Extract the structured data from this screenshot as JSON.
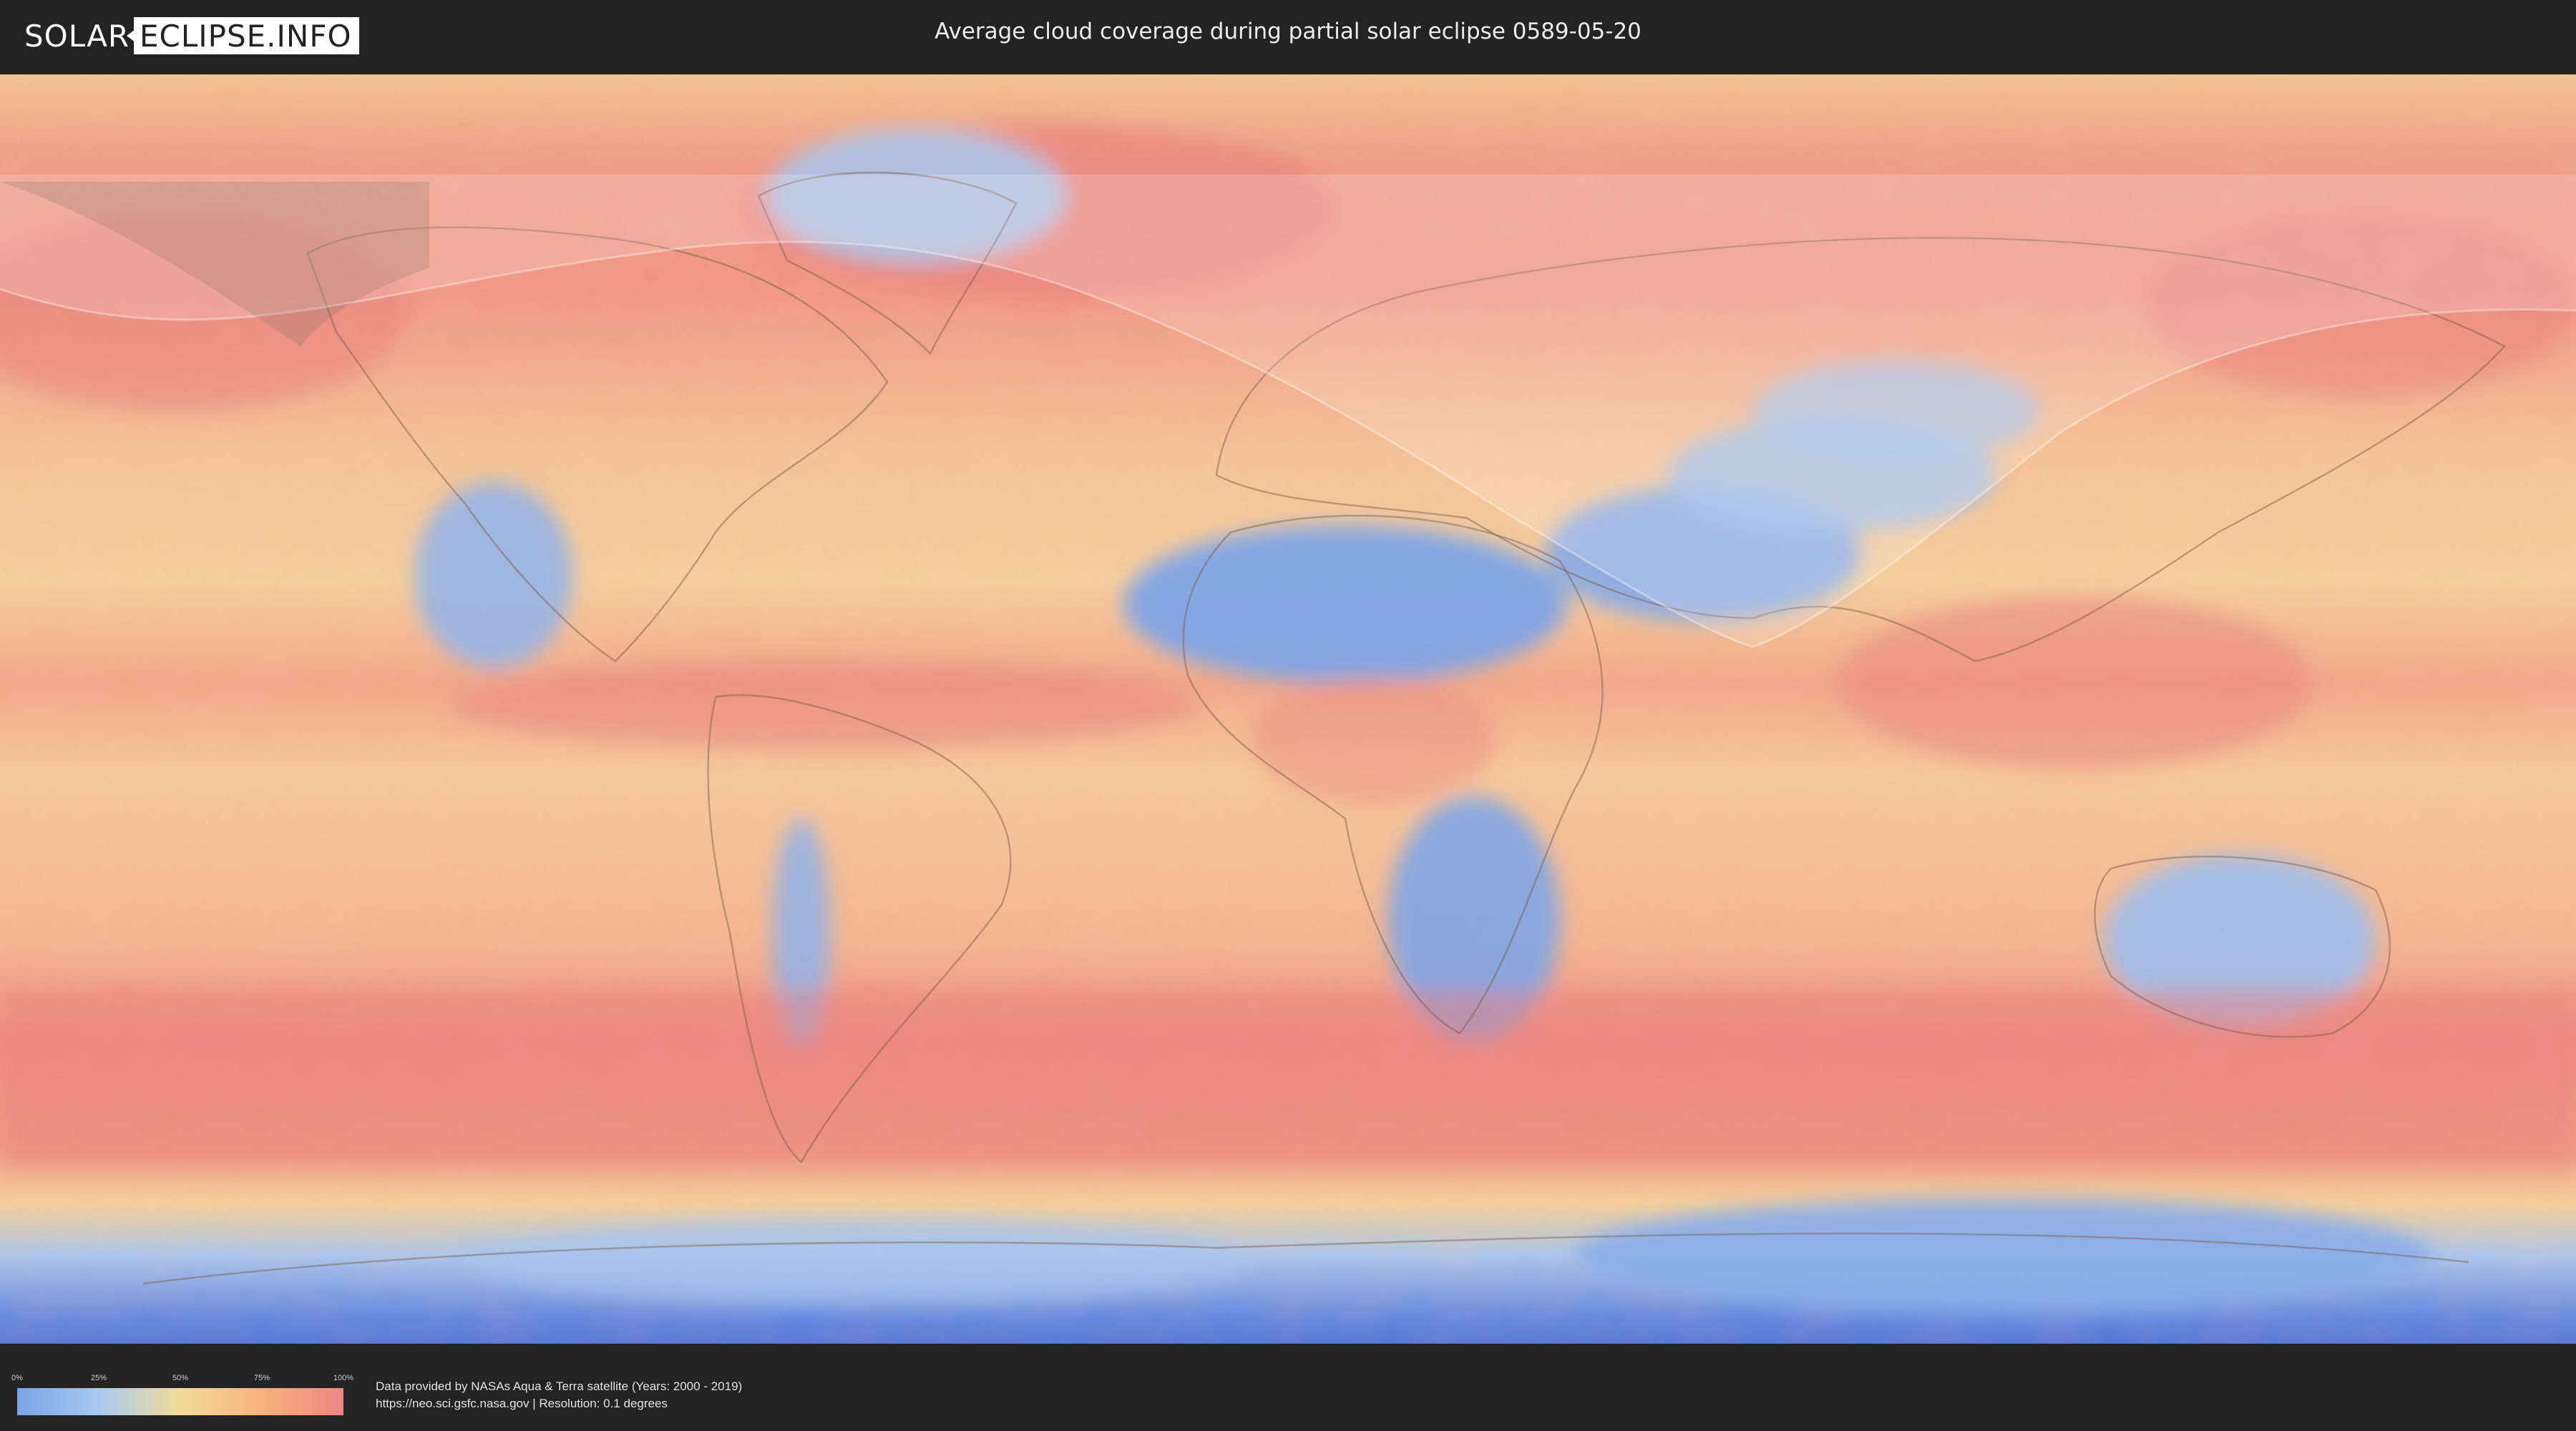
{
  "header": {
    "logo_left": "SOLAR",
    "logo_right": "ECLIPSE.INFO",
    "title": "Average cloud coverage during partial solar eclipse 0589-05-20"
  },
  "legend": {
    "ticks": [
      "0%",
      "25%",
      "50%",
      "75%",
      "100%"
    ],
    "gradient_colors": [
      "#7aa3e6",
      "#a9c9ef",
      "#f4dc9a",
      "#f6b27a",
      "#ee8585"
    ]
  },
  "footer": {
    "credit_line1": "Data provided by NASAs Aqua & Terra satellite (Years: 2000 - 2019)",
    "credit_line2": "https://neo.sci.gsfc.nasa.gov | Resolution: 0.1 degrees"
  },
  "map": {
    "projection": "equirectangular",
    "layer": "average cloud coverage",
    "eclipse_visibility_overlay": "partial eclipse shadow zone (lighter band)"
  }
}
